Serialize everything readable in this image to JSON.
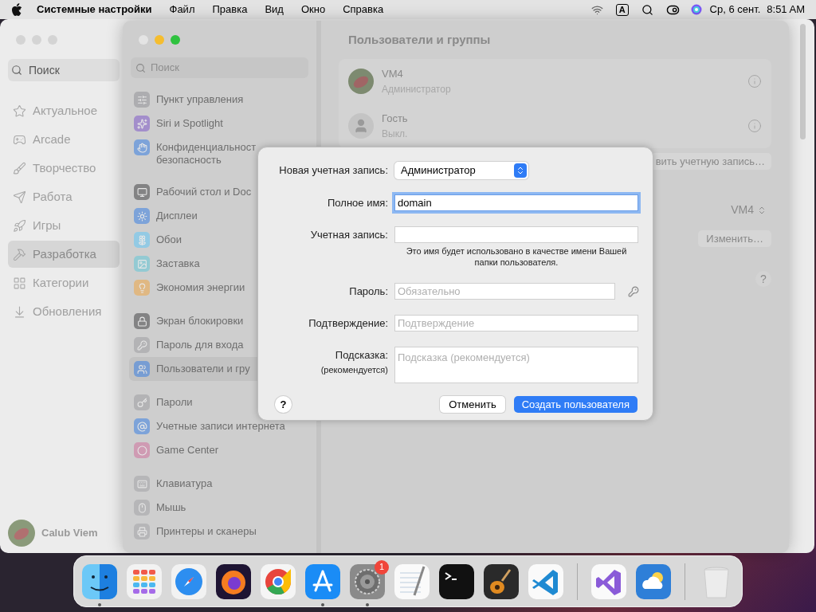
{
  "menu_bar": {
    "app_name": "Системные настройки",
    "menus": [
      "Файл",
      "Правка",
      "Вид",
      "Окно",
      "Справка"
    ],
    "input_source": "A",
    "date": "Ср, 6 сент.",
    "time": "8:51 AM"
  },
  "app_store": {
    "search": {
      "placeholder": "Поиск"
    },
    "nav": [
      {
        "label": "Актуальное",
        "kind": "star",
        "selected": false
      },
      {
        "label": "Arcade",
        "kind": "joystick",
        "selected": false
      },
      {
        "label": "Творчество",
        "kind": "brush",
        "selected": false
      },
      {
        "label": "Работа",
        "kind": "plane",
        "selected": false
      },
      {
        "label": "Игры",
        "kind": "rocket",
        "selected": false
      },
      {
        "label": "Разработка",
        "kind": "hammer",
        "selected": true
      },
      {
        "label": "Категории",
        "kind": "grid",
        "selected": false
      },
      {
        "label": "Обновления",
        "kind": "download",
        "selected": false
      }
    ],
    "account": {
      "name": "Calub Viem"
    }
  },
  "settings": {
    "title": "Пользователи и группы",
    "search": {
      "placeholder": "Поиск"
    },
    "sidebar_groups": [
      [
        {
          "label": "Пункт управления",
          "kind": "control",
          "selected": false
        },
        {
          "label": "Siri и Spotlight",
          "kind": "siri",
          "selected": false
        },
        {
          "label": "Конфиденциальност",
          "second_line": "безопасность",
          "kind": "privacy",
          "selected": false
        }
      ],
      [
        {
          "label": "Рабочий стол и Doc",
          "kind": "desktop",
          "selected": false
        },
        {
          "label": "Дисплеи",
          "kind": "display",
          "selected": false
        },
        {
          "label": "Обои",
          "kind": "wallpaper",
          "selected": false
        },
        {
          "label": "Заставка",
          "kind": "screensaver",
          "selected": false
        },
        {
          "label": "Экономия энергии",
          "kind": "energy",
          "selected": false
        }
      ],
      [
        {
          "label": "Экран блокировки",
          "kind": "lock",
          "selected": false
        },
        {
          "label": "Пароль для входа",
          "kind": "login",
          "selected": false
        },
        {
          "label": "Пользователи и гру",
          "kind": "users",
          "selected": true
        }
      ],
      [
        {
          "label": "Пароли",
          "kind": "key",
          "selected": false
        },
        {
          "label": "Учетные записи интернета",
          "kind": "at",
          "selected": false
        },
        {
          "label": "Game Center",
          "kind": "game",
          "selected": false
        }
      ],
      [
        {
          "label": "Клавиатура",
          "kind": "keyboard",
          "selected": false
        },
        {
          "label": "Мышь",
          "kind": "mouse",
          "selected": false
        },
        {
          "label": "Принтеры и сканеры",
          "kind": "printer",
          "selected": false
        }
      ]
    ],
    "users": [
      {
        "name": "VM4",
        "role": "Администратор",
        "kind": "photo"
      },
      {
        "name": "Гость",
        "role": "Выкл.",
        "kind": "guest"
      }
    ],
    "add_account_button": "вить учетную запись…",
    "auto_login": {
      "value": "VM4"
    },
    "edit_button": "Изменить…",
    "help": "?"
  },
  "dialog": {
    "account_type": {
      "label": "Новая учетная запись:",
      "value": "Администратор"
    },
    "fields": [
      {
        "kind": "text",
        "label": "Полное имя:",
        "value": "domain",
        "focused": true
      },
      {
        "kind": "text",
        "label": "Учетная запись:",
        "focused": false,
        "note": "Это имя будет использовано в качестве имени Вашей папки пользователя."
      },
      {
        "kind": "password",
        "label": "Пароль:",
        "placeholder": "Обязательно",
        "focused": false
      },
      {
        "kind": "text",
        "label": "Подтверждение:",
        "placeholder": "Подтверждение",
        "focused": false
      },
      {
        "kind": "multiline",
        "label": "Подсказка:",
        "sublabel": "(рекомендуется)",
        "placeholder": "Подсказка (рекомендуется)",
        "focused": false
      }
    ],
    "help": "?",
    "cancel": "Отменить",
    "create": "Создать пользователя"
  },
  "dock": {
    "apps": [
      {
        "kind": "finder",
        "running": true
      },
      {
        "kind": "launchpad",
        "running": false
      },
      {
        "kind": "safari",
        "running": false
      },
      {
        "kind": "firefox",
        "running": false
      },
      {
        "kind": "chrome",
        "running": false
      },
      {
        "kind": "appstore",
        "running": true
      },
      {
        "kind": "settings",
        "running": true,
        "badge": "1"
      },
      {
        "kind": "textedit",
        "running": false
      },
      {
        "kind": "terminal",
        "running": false
      },
      {
        "kind": "guitar",
        "running": false
      },
      {
        "kind": "vscode",
        "running": false
      },
      {
        "kind": "separator"
      },
      {
        "kind": "vs",
        "running": false
      },
      {
        "kind": "weather",
        "running": false
      },
      {
        "kind": "separator"
      },
      {
        "kind": "trash",
        "running": false
      }
    ]
  }
}
